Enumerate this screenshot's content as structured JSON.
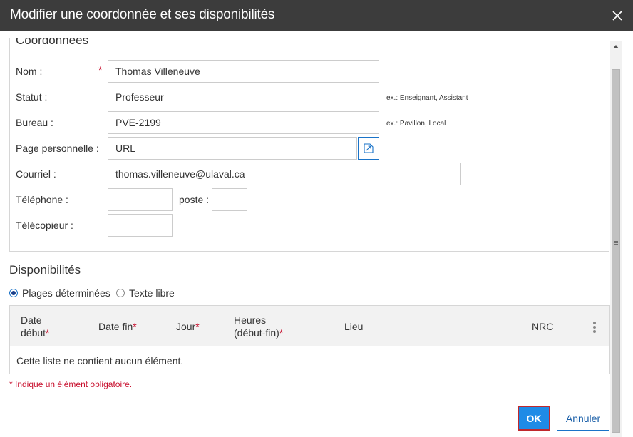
{
  "dialog": {
    "title": "Modifier une coordonnée et ses disponibilités"
  },
  "coordonnees": {
    "section_title": "Coordonnées",
    "nom": {
      "label": "Nom :",
      "required_marker": "*",
      "value": "Thomas Villeneuve"
    },
    "statut": {
      "label": "Statut :",
      "value": "Professeur",
      "hint": "ex.: Enseignant, Assistant"
    },
    "bureau": {
      "label": "Bureau :",
      "value": "PVE-2199",
      "hint": "ex.: Pavillon, Local"
    },
    "page_perso": {
      "label": "Page personnelle :",
      "value": "URL"
    },
    "courriel": {
      "label": "Courriel :",
      "value": "thomas.villeneuve@ulaval.ca"
    },
    "telephone": {
      "label": "Téléphone :",
      "value": "",
      "poste_label": "poste :",
      "poste_value": ""
    },
    "telecopieur": {
      "label": "Télécopieur :",
      "value": ""
    }
  },
  "disponibilites": {
    "section_title": "Disponibilités",
    "options": [
      {
        "label": "Plages déterminées",
        "selected": true
      },
      {
        "label": "Texte libre",
        "selected": false
      }
    ],
    "table": {
      "columns": [
        {
          "line1": "Date",
          "line2": "début",
          "required": true
        },
        {
          "line1": "Date fin",
          "line2": "",
          "required": true
        },
        {
          "line1": "Jour",
          "line2": "",
          "required": true
        },
        {
          "line1": "Heures",
          "line2": "(début-fin)",
          "required": true
        },
        {
          "line1": "Lieu",
          "line2": "",
          "required": false
        },
        {
          "line1": "NRC",
          "line2": "",
          "required": false
        }
      ],
      "empty_message": "Cette liste ne contient aucun élément."
    }
  },
  "required_note": "* Indique un élément obligatoire.",
  "buttons": {
    "ok": "OK",
    "cancel": "Annuler"
  },
  "colors": {
    "titlebar": "#3c3c3c",
    "accent": "#1e8be6",
    "required": "#c8102e"
  }
}
